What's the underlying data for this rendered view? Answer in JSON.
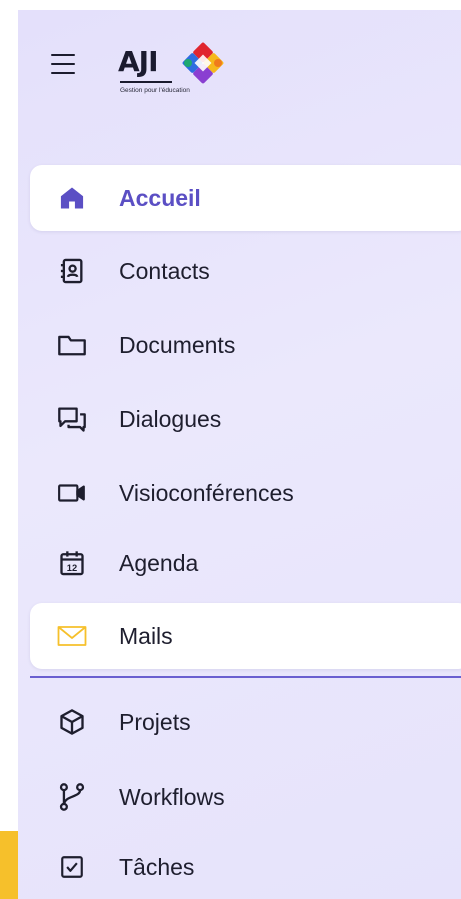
{
  "logo": {
    "text": "AJI",
    "tagline": "Gestion pour l'éducation",
    "colors": [
      "#e0262f",
      "#f6b81c",
      "#2e6de0",
      "#1ea971",
      "#8a3fd1",
      "#f07b1c"
    ]
  },
  "colors": {
    "accent": "#5b4fc4",
    "mail_icon": "#f6c02b",
    "divider": "#6a5fd0",
    "strip": "#f6c02b"
  },
  "nav": {
    "items": [
      {
        "label": "Accueil",
        "icon": "home-icon",
        "active": true
      },
      {
        "label": "Contacts",
        "icon": "contacts-book-icon"
      },
      {
        "label": "Documents",
        "icon": "folder-icon"
      },
      {
        "label": "Dialogues",
        "icon": "chat-bubbles-icon"
      },
      {
        "label": "Visioconférences",
        "icon": "video-camera-icon"
      },
      {
        "label": "Agenda",
        "icon": "calendar-icon",
        "icon_text": "12"
      },
      {
        "label": "Mails",
        "icon": "mail-envelope-icon",
        "highlighted": true
      },
      {
        "label": "Projets",
        "icon": "cube-icon"
      },
      {
        "label": "Workflows",
        "icon": "git-branch-icon"
      },
      {
        "label": "Tâches",
        "icon": "checkbox-icon"
      }
    ]
  }
}
